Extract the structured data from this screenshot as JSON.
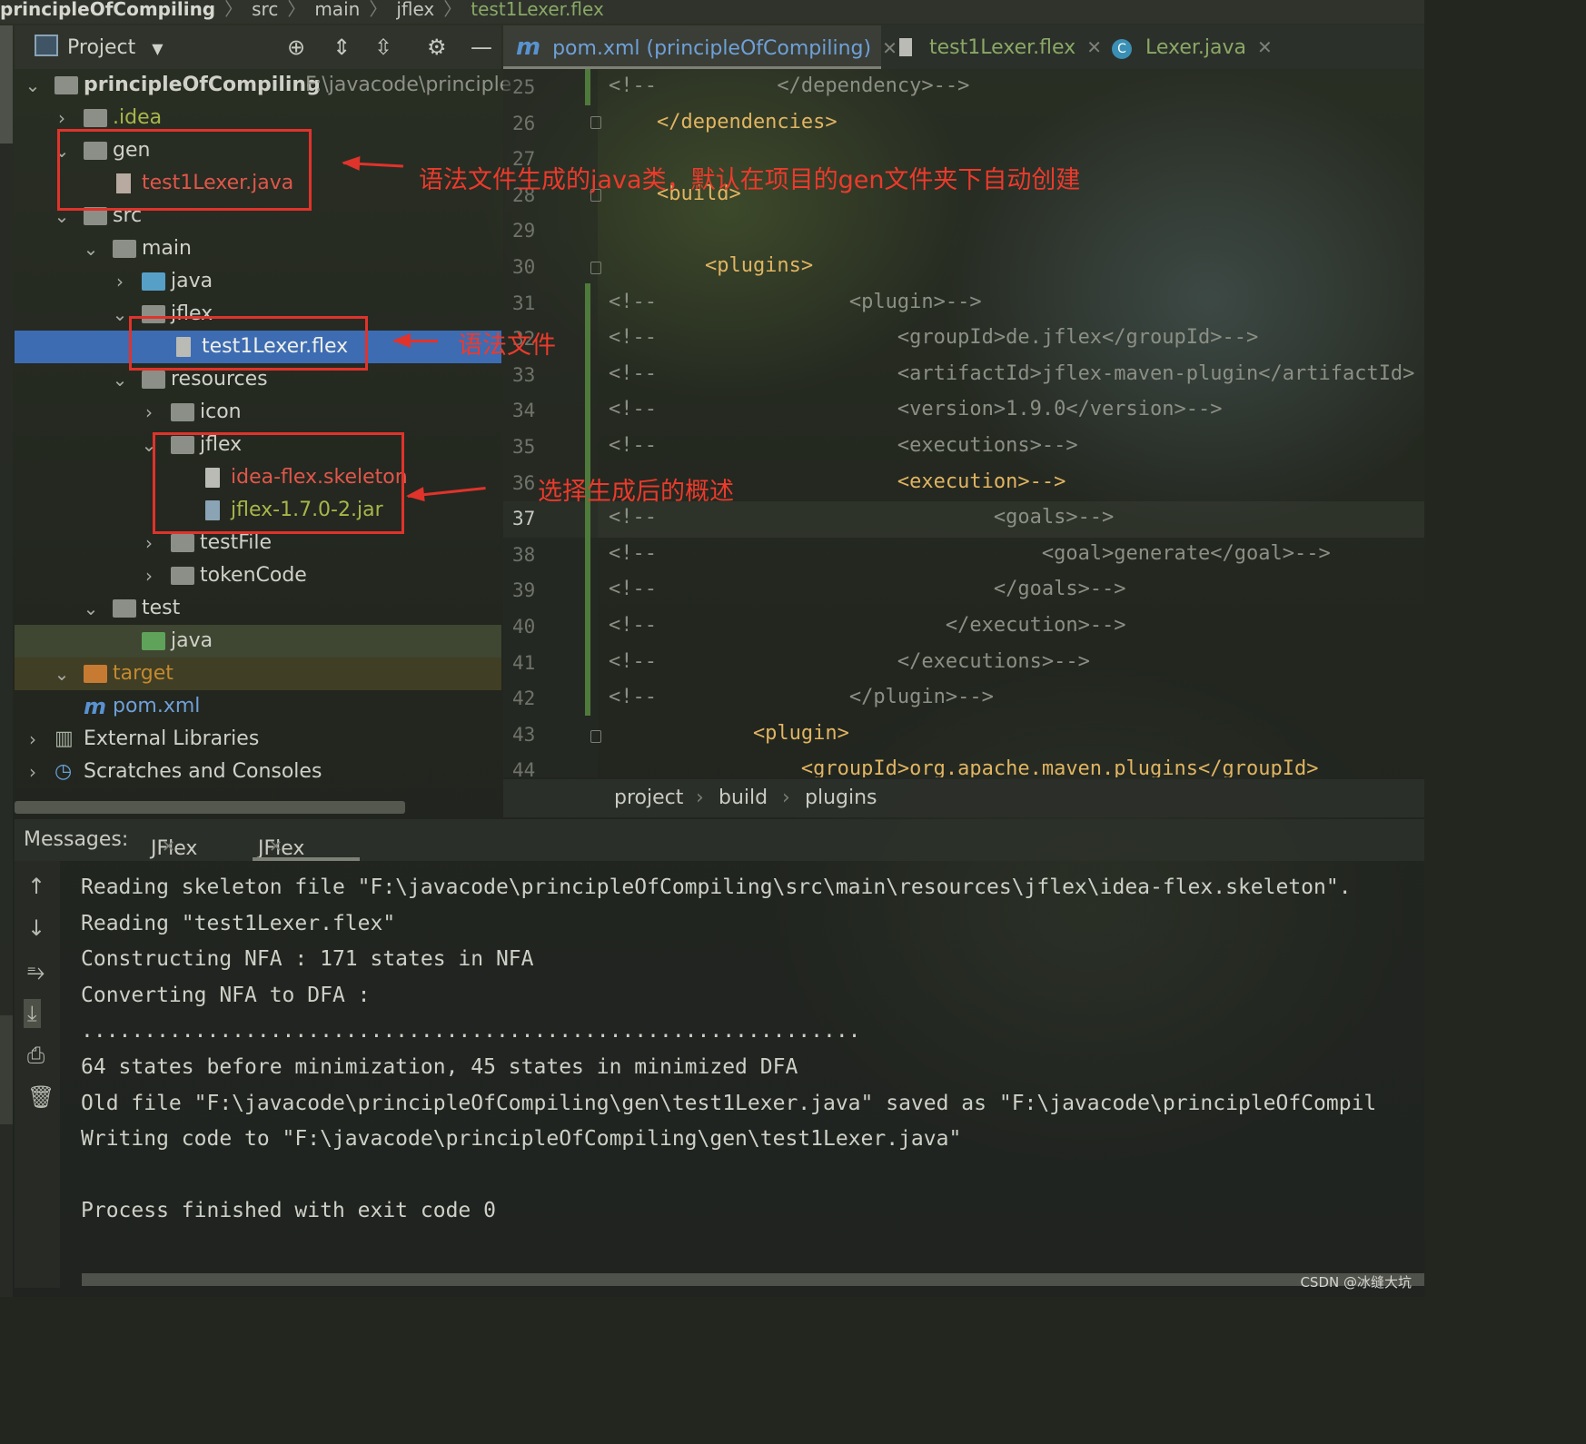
{
  "breadcrumb": [
    "principleOfCompiling",
    "src",
    "main",
    "jflex",
    "test1Lexer.flex"
  ],
  "project_panel": {
    "title": "Project",
    "tree": [
      {
        "label": "principleOfCompiling",
        "path": "F:\\javacode\\principle",
        "icon": "module-folder-icon"
      },
      {
        "label": ".idea",
        "icon": "folder-icon"
      },
      {
        "label": "gen",
        "icon": "folder-icon"
      },
      {
        "label": "test1Lexer.java",
        "icon": "java-file-icon"
      },
      {
        "label": "src",
        "icon": "folder-icon"
      },
      {
        "label": "main",
        "icon": "folder-icon"
      },
      {
        "label": "java",
        "icon": "source-folder-icon"
      },
      {
        "label": "jflex",
        "icon": "folder-icon"
      },
      {
        "label": "test1Lexer.flex",
        "icon": "file-icon"
      },
      {
        "label": "resources",
        "icon": "resources-folder-icon"
      },
      {
        "label": "icon",
        "icon": "folder-icon"
      },
      {
        "label": "jflex",
        "icon": "folder-icon"
      },
      {
        "label": "idea-flex.skeleton",
        "icon": "file-icon"
      },
      {
        "label": "jflex-1.7.0-2.jar",
        "icon": "jar-icon"
      },
      {
        "label": "testFile",
        "icon": "folder-icon"
      },
      {
        "label": "tokenCode",
        "icon": "folder-icon"
      },
      {
        "label": "test",
        "icon": "folder-icon"
      },
      {
        "label": "java",
        "icon": "test-folder-icon"
      },
      {
        "label": "target",
        "icon": "excluded-folder-icon"
      },
      {
        "label": "pom.xml",
        "icon": "maven-icon"
      },
      {
        "label": "External Libraries",
        "icon": "library-icon"
      },
      {
        "label": "Scratches and Consoles",
        "icon": "scratch-icon"
      }
    ]
  },
  "editor": {
    "tabs": [
      {
        "label": "pom.xml (principleOfCompiling)",
        "icon": "maven-icon",
        "active": true
      },
      {
        "label": "test1Lexer.flex",
        "icon": "file-icon",
        "active": false
      },
      {
        "label": "Lexer.java",
        "icon": "class-icon",
        "active": false
      }
    ],
    "line_numbers": [
      "25",
      "26",
      "27",
      "28",
      "29",
      "30",
      "31",
      "32",
      "33",
      "34",
      "35",
      "36",
      "37",
      "38",
      "39",
      "40",
      "41",
      "42",
      "43",
      "44"
    ],
    "current_line": "37",
    "lines": [
      {
        "comment": "<!--",
        "text": "          </dependency>-->"
      },
      {
        "comment": "",
        "text": "    </dependencies>"
      },
      {
        "comment": "",
        "text": ""
      },
      {
        "comment": "",
        "text": "    <build>"
      },
      {
        "comment": "",
        "text": ""
      },
      {
        "comment": "",
        "text": "        <plugins>"
      },
      {
        "comment": "<!--",
        "text": "                <plugin>-->"
      },
      {
        "comment": "<!--",
        "text": "                    <groupId>de.jflex</groupId>-->"
      },
      {
        "comment": "<!--",
        "text": "                    <artifactId>jflex-maven-plugin</artifactId>"
      },
      {
        "comment": "<!--",
        "text": "                    <version>1.9.0</version>-->"
      },
      {
        "comment": "<!--",
        "text": "                    <executions>-->"
      },
      {
        "comment": "",
        "text": "                        <execution>-->"
      },
      {
        "comment": "<!--",
        "text": "                            <goals>-->"
      },
      {
        "comment": "<!--",
        "text": "                                <goal>generate</goal>-->"
      },
      {
        "comment": "<!--",
        "text": "                            </goals>-->"
      },
      {
        "comment": "<!--",
        "text": "                        </execution>-->"
      },
      {
        "comment": "<!--",
        "text": "                    </executions>-->"
      },
      {
        "comment": "<!--",
        "text": "                </plugin>-->"
      },
      {
        "comment": "",
        "text": "            <plugin>"
      },
      {
        "comment": "",
        "text": "                <groupId>org.apache.maven.plugins</groupId>"
      }
    ],
    "breadcrumbs": [
      "project",
      "build",
      "plugins"
    ]
  },
  "annotations": {
    "gen": "语法文件生成的java类，默认在项目的gen文件夹下自动创建",
    "flex": "语法文件",
    "skeleton": "选择生成后的概述"
  },
  "messages": {
    "label": "Messages:",
    "tabs": [
      "JFlex",
      "JFlex"
    ],
    "lines": [
      "Reading skeleton file \"F:\\javacode\\principleOfCompiling\\src\\main\\resources\\jflex\\idea-flex.skeleton\".",
      "Reading \"test1Lexer.flex\"",
      "Constructing NFA : 171 states in NFA",
      "Converting NFA to DFA :",
      "..............................................................",
      "64 states before minimization, 45 states in minimized DFA",
      "Old file \"F:\\javacode\\principleOfCompiling\\gen\\test1Lexer.java\" saved as \"F:\\javacode\\principleOfCompil",
      "Writing code to \"F:\\javacode\\principleOfCompiling\\gen\\test1Lexer.java\"",
      "",
      "Process finished with exit code 0"
    ]
  },
  "watermark": "CSDN @冰缝大坑",
  "colors": {
    "annotation": "#e0332b",
    "selection": "#3d6cb3",
    "xml_tag": "#e0b461",
    "comment": "#8b8f84"
  }
}
